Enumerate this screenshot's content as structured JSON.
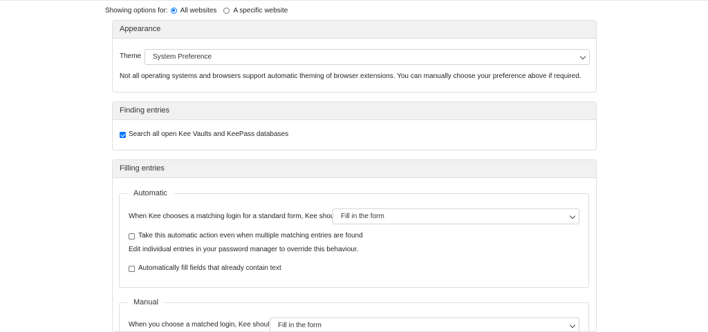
{
  "scope": {
    "label": "Showing options for:",
    "all_websites": "All websites",
    "specific_website": "A specific website",
    "selected": "All websites"
  },
  "appearance": {
    "title": "Appearance",
    "theme_label": "Theme",
    "theme_value": "System Preference",
    "note": "Not all operating systems and browsers support automatic theming of browser extensions. You can manually choose your preference above if required."
  },
  "finding": {
    "title": "Finding entries",
    "search_all_label": "Search all open Kee Vaults and KeePass databases",
    "search_all_checked": true
  },
  "filling": {
    "title": "Filling entries",
    "automatic": {
      "legend": "Automatic",
      "action_label": "When Kee chooses a matching login for a standard form, Kee should",
      "action_value": "Fill in the form",
      "multiple_label": "Take this automatic action even when multiple matching entries are found",
      "multiple_checked": false,
      "override_note": "Edit individual entries in your password manager to override this behaviour.",
      "fill_existing_label": "Automatically fill fields that already contain text",
      "fill_existing_checked": false
    },
    "manual": {
      "legend": "Manual",
      "action_label": "When you choose a matched login, Kee should",
      "action_value": "Fill in the form"
    }
  },
  "colors": {
    "accent": "#0075ff",
    "header_bg": "#f1f1f1",
    "border": "#dfdfdf"
  }
}
